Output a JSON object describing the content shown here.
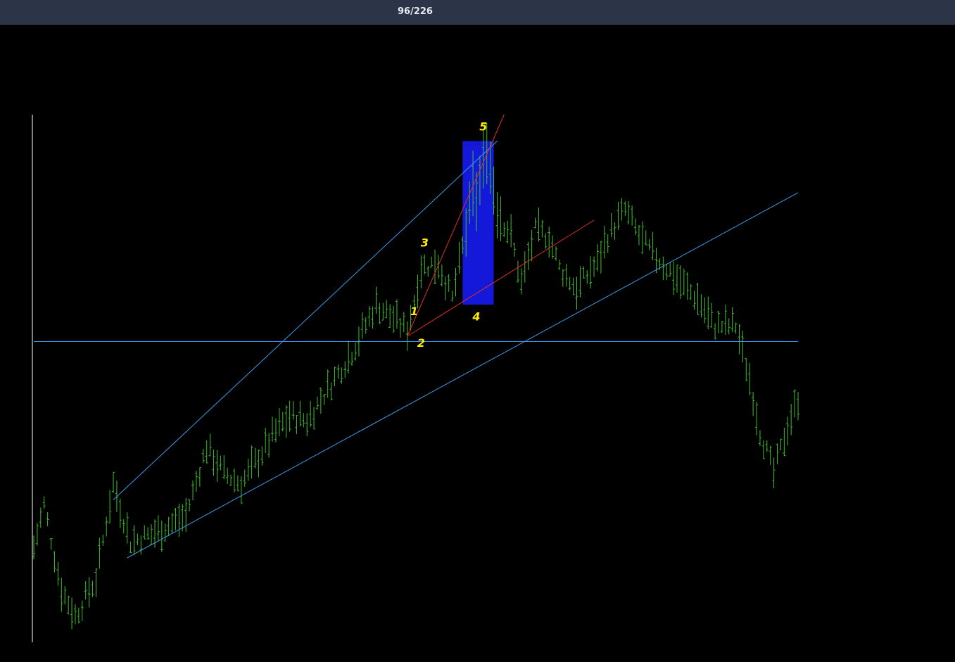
{
  "viewer": {
    "counter": "96/226"
  },
  "colors": {
    "background": "#000000",
    "topbar": "#2c3447",
    "bar": "#3fbf2a",
    "trendline_blue": "#3a9be8",
    "trendline_red": "#e0301e",
    "highlight_box": "#1418d8",
    "wave_labels": "#ffeb00",
    "axis": "#ffffff"
  },
  "chart_data": {
    "type": "ohlc-bar",
    "title": "",
    "xlabel": "",
    "ylabel": "",
    "x_range": [
      0,
      180
    ],
    "y_range": [
      0,
      100
    ],
    "grid": false,
    "axis_ticks": "none",
    "anchors": [
      [
        0,
        18
      ],
      [
        3,
        26
      ],
      [
        8,
        10
      ],
      [
        12,
        5
      ],
      [
        18,
        12
      ],
      [
        23,
        30
      ],
      [
        28,
        19
      ],
      [
        36,
        21
      ],
      [
        44,
        24
      ],
      [
        50,
        37
      ],
      [
        55,
        32
      ],
      [
        60,
        30
      ],
      [
        64,
        34
      ],
      [
        70,
        40
      ],
      [
        74,
        43
      ],
      [
        79,
        42
      ],
      [
        86,
        49
      ],
      [
        92,
        55
      ],
      [
        99,
        64
      ],
      [
        103,
        62
      ],
      [
        108,
        59
      ],
      [
        112,
        71
      ],
      [
        117,
        72
      ],
      [
        121,
        65
      ],
      [
        125,
        78
      ],
      [
        127,
        86
      ],
      [
        128,
        84
      ],
      [
        131,
        94
      ],
      [
        134,
        82
      ],
      [
        138,
        77
      ],
      [
        141,
        68
      ],
      [
        145,
        78
      ],
      [
        149,
        77
      ],
      [
        152,
        71
      ],
      [
        157,
        67
      ],
      [
        163,
        72
      ],
      [
        166,
        77
      ],
      [
        171,
        82
      ],
      [
        176,
        76
      ],
      [
        180,
        73
      ],
      [
        186,
        69
      ],
      [
        192,
        65
      ],
      [
        197,
        60
      ],
      [
        203,
        60
      ],
      [
        207,
        50
      ],
      [
        210,
        40
      ],
      [
        214,
        32
      ],
      [
        218,
        41
      ],
      [
        221,
        46
      ]
    ],
    "trendlines": [
      {
        "name": "lower-support",
        "color": "blue",
        "from": [
          27,
          16
        ],
        "to": [
          240,
          92
        ]
      },
      {
        "name": "upper-channel",
        "color": "blue",
        "from": [
          23,
          27
        ],
        "to": [
          134,
          95
        ]
      },
      {
        "name": "horizontal-level",
        "color": "blue",
        "from": [
          0,
          57
        ],
        "to": [
          240,
          57
        ]
      },
      {
        "name": "wave-1-3-5",
        "color": "red",
        "from": [
          108,
          58
        ],
        "to": [
          136,
          100
        ]
      },
      {
        "name": "wave-2-4-extension",
        "color": "red",
        "from": [
          108,
          58
        ],
        "to": [
          162,
          80
        ]
      }
    ],
    "highlight_zone": {
      "x": [
        124,
        133
      ],
      "y": [
        64,
        95
      ]
    },
    "wave_labels": [
      {
        "text": "1",
        "x": 110,
        "y": 62
      },
      {
        "text": "2",
        "x": 112,
        "y": 56
      },
      {
        "text": "3",
        "x": 113,
        "y": 75
      },
      {
        "text": "4",
        "x": 128,
        "y": 61
      },
      {
        "text": "5",
        "x": 130,
        "y": 97
      }
    ]
  }
}
